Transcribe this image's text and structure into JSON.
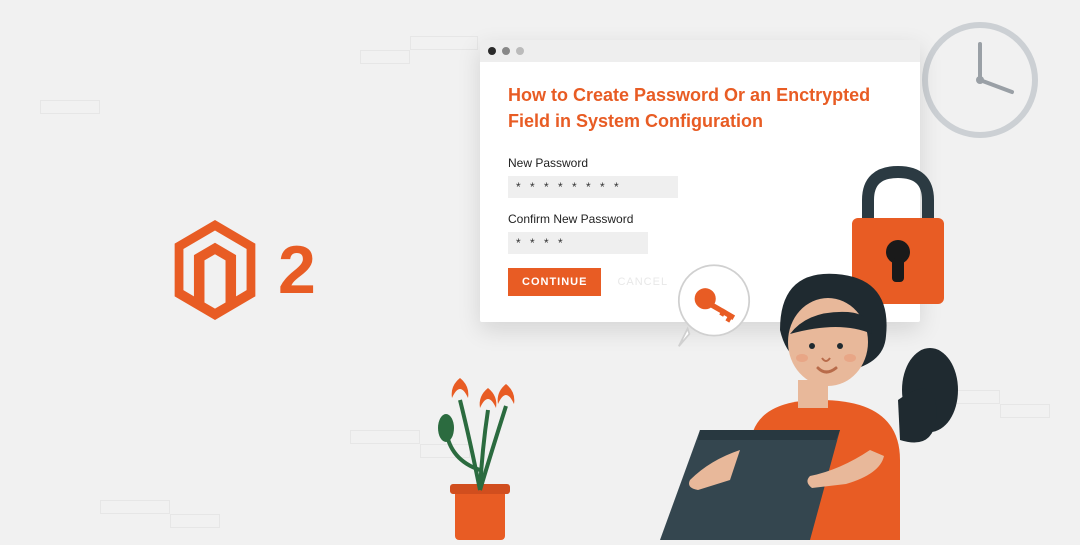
{
  "logo": {
    "version_text": "2"
  },
  "window": {
    "heading": "How to Create Password Or an Enctrypted Field in System Configuration",
    "fields": {
      "new_password": {
        "label": "New Password",
        "value": "* * * * * * * *"
      },
      "confirm_password": {
        "label": "Confirm New Password",
        "value": "* * * *"
      }
    },
    "buttons": {
      "continue": "CONTINUE",
      "cancel": "CANCEL"
    }
  }
}
